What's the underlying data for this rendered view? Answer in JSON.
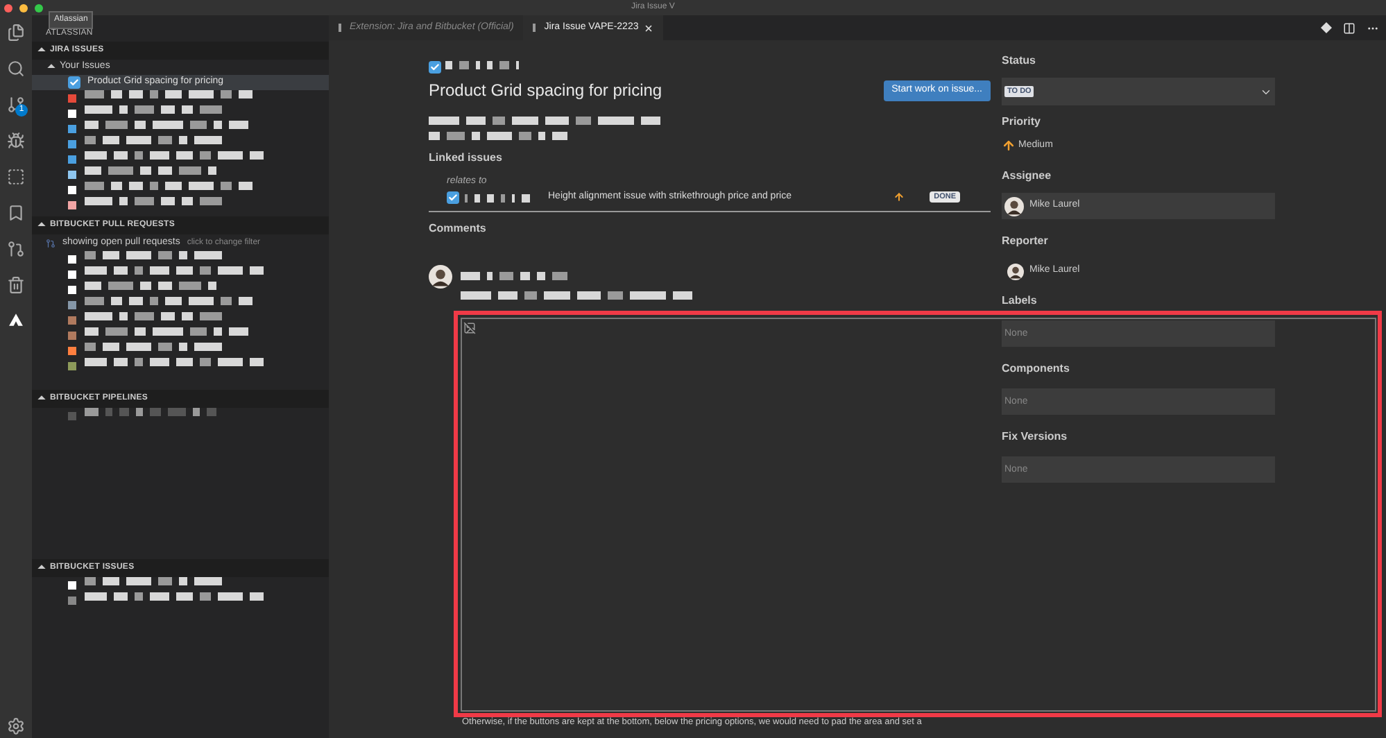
{
  "window": {
    "title": "Jira Issue V"
  },
  "tooltip": "Atlassian",
  "activity_bar": {
    "badge": "1"
  },
  "sidebar": {
    "header": "ATLASSIAN",
    "sections": [
      {
        "title": "JIRA ISSUES",
        "expanded": true,
        "kind": "jira",
        "group": "Your Issues",
        "selected_issue": {
          "summary": "Product Grid spacing for pricing",
          "selected": true
        },
        "rows": [
          {
            "kind": "redacted",
            "color": "#e5493a"
          },
          {
            "kind": "redacted",
            "color": "#ffffff"
          },
          {
            "kind": "redacted",
            "color": "#4a9fe0"
          },
          {
            "kind": "redacted",
            "color": "#4a9fe0"
          },
          {
            "kind": "redacted",
            "color": "#4a9fe0"
          },
          {
            "kind": "redacted",
            "color": "#8ec6ef"
          },
          {
            "kind": "redacted",
            "color": "#ffffff"
          },
          {
            "kind": "redacted",
            "color": "#f2a5a5"
          }
        ]
      },
      {
        "title": "BITBUCKET PULL REQUESTS",
        "expanded": true,
        "kind": "pr",
        "filter": "showing open pull requests",
        "filter_hint": "click to change filter",
        "rows": [
          {
            "kind": "redacted",
            "color": "#ffffff"
          },
          {
            "kind": "redacted",
            "color": "#ffffff"
          },
          {
            "kind": "redacted",
            "color": "#ffffff"
          },
          {
            "kind": "redacted",
            "color": "#8597a8"
          },
          {
            "kind": "redacted",
            "color": "#b07a5e"
          },
          {
            "kind": "redacted",
            "color": "#b07a5e"
          },
          {
            "kind": "redacted",
            "color": "#ff7f3f"
          },
          {
            "kind": "redacted",
            "color": "#8d9a5a"
          }
        ]
      },
      {
        "title": "BITBUCKET PIPELINES",
        "expanded": true,
        "kind": "pipelines",
        "rows": [
          {
            "kind": "redacted",
            "color": "#555555"
          }
        ]
      },
      {
        "title": "BITBUCKET ISSUES",
        "expanded": true,
        "kind": "issues",
        "rows": [
          {
            "kind": "redacted",
            "color": "#ffffff"
          },
          {
            "kind": "redacted",
            "color": "#888888"
          }
        ]
      }
    ]
  },
  "tabs": [
    {
      "label": "Extension: Jira and Bitbucket (Official)",
      "selected": false
    },
    {
      "label": "Jira Issue VAPE-2223",
      "selected": true
    }
  ],
  "issue": {
    "checked": true,
    "summary": "Product Grid spacing for pricing",
    "start_button": "Start work on issue...",
    "linked_heading": "Linked issues",
    "relation": "relates to",
    "linked": [
      {
        "checked": true,
        "summary": "Height alignment issue with strikethrough price and price",
        "status": "DONE"
      }
    ],
    "comments_heading": "Comments",
    "comment_tail": "Otherwise, if the buttons are kept at the bottom, below the pricing options, we would need to pad the area and set a"
  },
  "details": {
    "status_label": "Status",
    "status": "TO DO",
    "priority_label": "Priority",
    "priority": "Medium",
    "assignee_label": "Assignee",
    "assignee": "Mike Laurel",
    "reporter_label": "Reporter",
    "reporter": "Mike Laurel",
    "fields": [
      {
        "label": "Labels",
        "placeholder": "None"
      },
      {
        "label": "Components",
        "placeholder": "None"
      },
      {
        "label": "Fix Versions",
        "placeholder": "None"
      }
    ]
  }
}
